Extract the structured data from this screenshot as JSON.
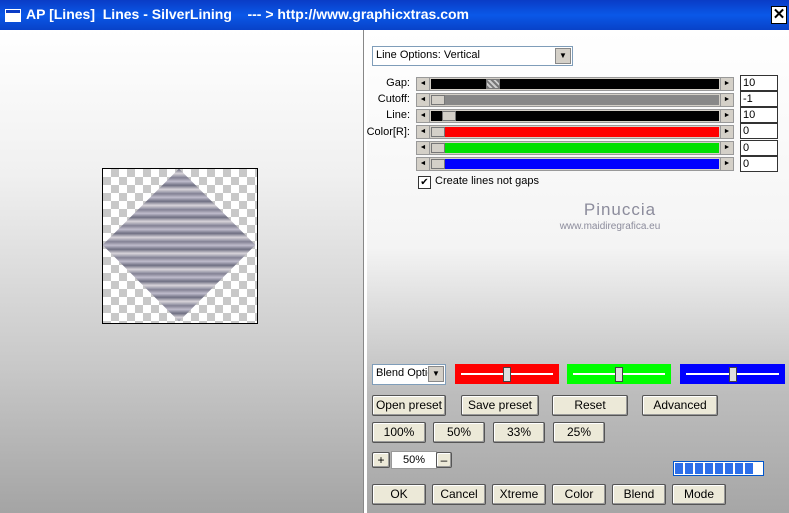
{
  "window": {
    "title": "AP [Lines]  Lines - SilverLining    --- > http://www.graphicxtras.com",
    "close": "✕"
  },
  "options_dropdown": {
    "value": "Line Options: Vertical",
    "arrow": "▼"
  },
  "rows": [
    {
      "label": "Gap:",
      "value": "10",
      "fill": "#000000",
      "thumb": 0.2
    },
    {
      "label": "Cutoff:",
      "value": "-1",
      "fill": "#888888",
      "thumb": 0.0
    },
    {
      "label": "Line:",
      "value": "10",
      "fill": "#000000",
      "thumb": 0.04
    },
    {
      "label": "Color[R]:",
      "value": "0",
      "fill": "#ff0000",
      "thumb": 0.0
    },
    {
      "label": "",
      "value": "0",
      "fill": "#00e000",
      "thumb": 0.0
    },
    {
      "label": "",
      "value": "0",
      "fill": "#0000ff",
      "thumb": 0.0
    }
  ],
  "slider_arrows": {
    "left": "◄",
    "right": "►"
  },
  "checkbox": {
    "checked": true,
    "mark": "✔",
    "label": "Create lines not gaps"
  },
  "watermark": {
    "name": "Pinuccia",
    "site": "www.maidiregrafica.eu"
  },
  "blend_dropdown": {
    "value": "Blend Optio",
    "arrow": "▼"
  },
  "color_sliders": [
    {
      "color": "#ff0000",
      "level": 0.5
    },
    {
      "color": "#00ff00",
      "level": 0.5
    },
    {
      "color": "#0000ff",
      "level": 0.5
    }
  ],
  "buttons": {
    "open_preset": "Open preset",
    "save_preset": "Save preset",
    "reset": "Reset",
    "advanced": "Advanced",
    "zoom100": "100%",
    "zoom50": "50%",
    "zoom33": "33%",
    "zoom25": "25%",
    "ok": "OK",
    "cancel": "Cancel",
    "xtreme": "Xtreme",
    "color": "Color",
    "blend": "Blend",
    "mode": "Mode"
  },
  "zoom": {
    "plus": "+",
    "value": "50%",
    "minus": "–"
  },
  "progress": 0.9
}
